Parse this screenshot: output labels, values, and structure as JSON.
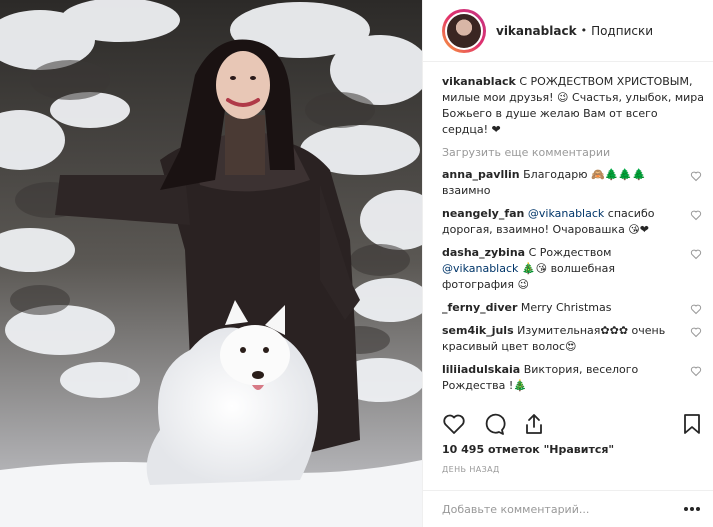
{
  "header": {
    "username": "vikanablack",
    "separator": "•",
    "follow_label": "Подписки"
  },
  "caption": {
    "username": "vikanablack",
    "text": "С РОЖДЕСТВОМ ХРИСТОВЫМ, милые мои друзья! 😉 Счастья, улыбок, мира Божьего в душе желаю Вам от всего сердца! ❤"
  },
  "load_more": "Загрузить еще комментарии",
  "comments": [
    {
      "username": "anna_pavllin",
      "text": "Благодарю 🙈🌲🌲🌲 взаимно",
      "mention": ""
    },
    {
      "username": "neangely_fan",
      "mention": "@vikanablack",
      "text": "спасибо дорогая, взаимно! Очаровашка 😘❤"
    },
    {
      "username": "dasha_zybina",
      "text": "С Рождеством",
      "mention": "@vikanablack",
      "text2": "🎄😘 волшебная фотография 😉"
    },
    {
      "username": "_ferny_diver",
      "text": "Merry Christmas",
      "mention": ""
    },
    {
      "username": "sem4ik_juls",
      "text": "Изумительная✿✿✿ очень красивый цвет волос😍",
      "mention": ""
    },
    {
      "username": "liliiadulskaia",
      "text": "Виктория, веселого Рождества !🎄",
      "mention": ""
    }
  ],
  "likes": {
    "count": "10 495",
    "label": "отметок \"Нравится\""
  },
  "date": "ДЕНЬ НАЗАД",
  "add_comment": {
    "placeholder": "Добавьте комментарий..."
  },
  "icons": {
    "like": "heart-icon",
    "comment": "comment-icon",
    "share": "share-icon",
    "save": "bookmark-icon",
    "more": "more-dots-icon"
  }
}
